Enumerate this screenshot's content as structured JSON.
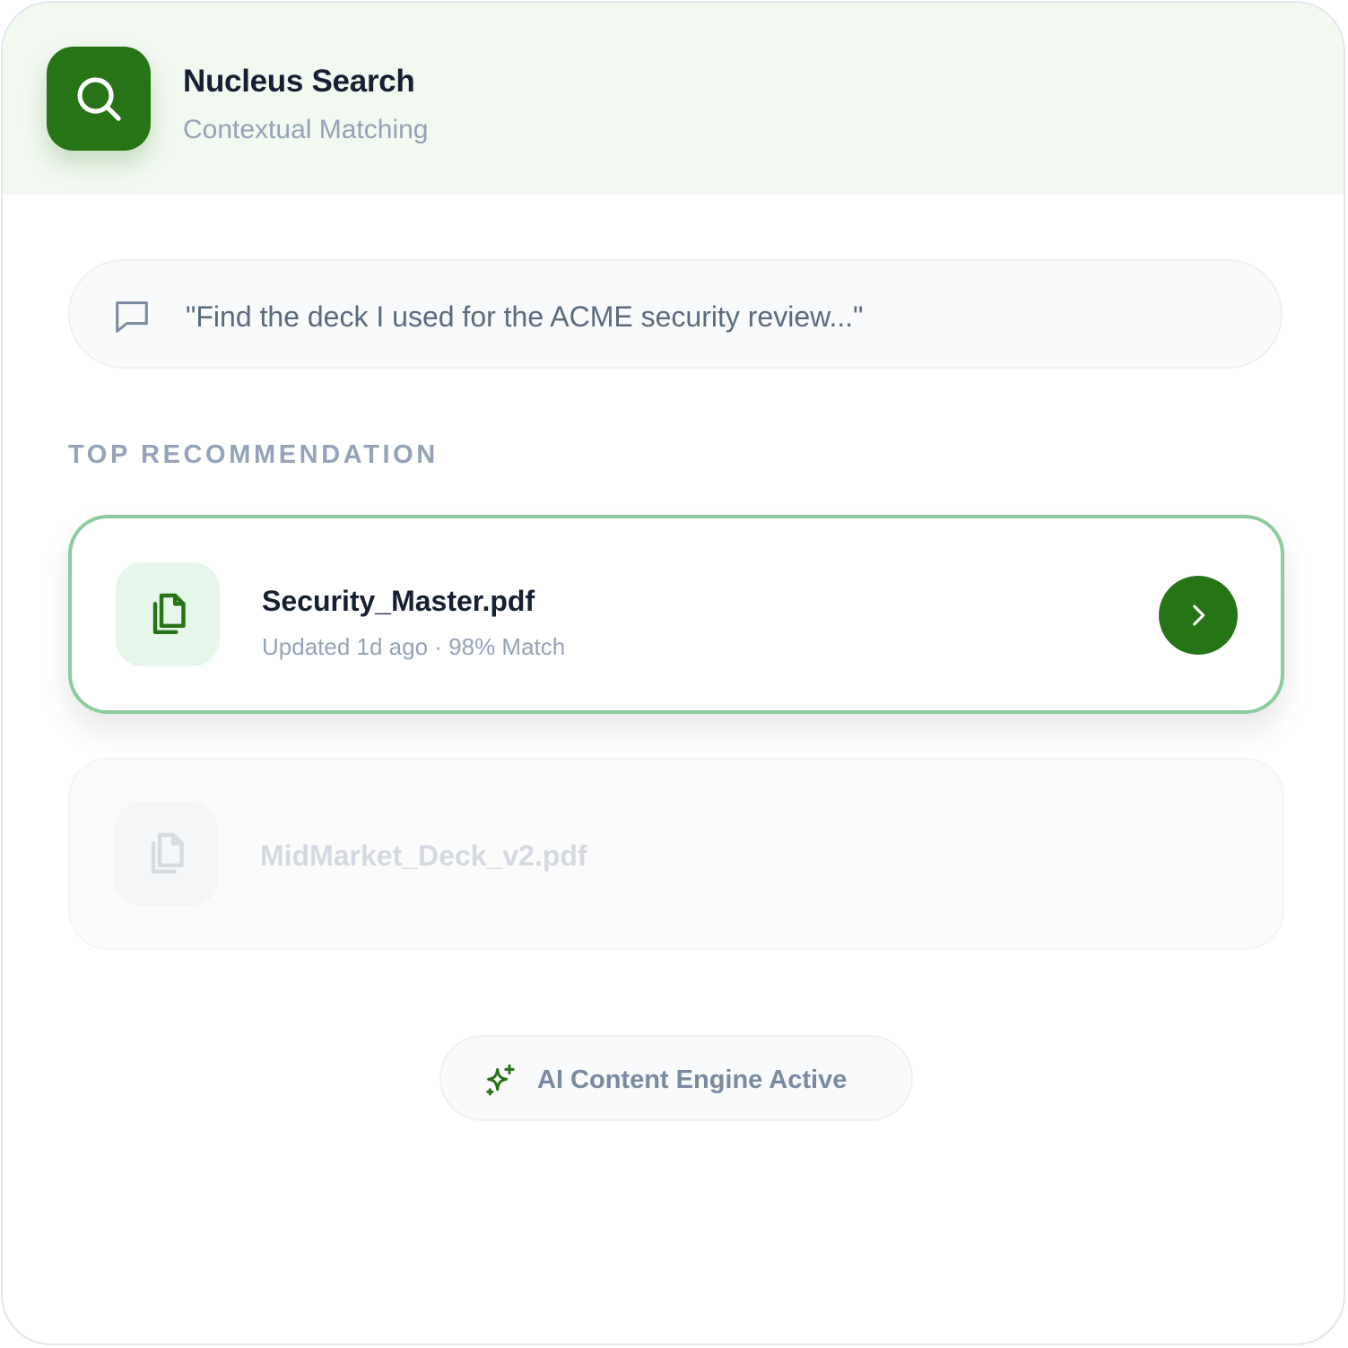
{
  "header": {
    "title": "Nucleus Search",
    "subtitle": "Contextual Matching",
    "icon": "search-icon"
  },
  "query": {
    "icon": "chat-bubble-icon",
    "text": "\"Find the deck I used for the ACME security review...\""
  },
  "section": {
    "label": "TOP RECOMMENDATION"
  },
  "results": [
    {
      "name": "Security_Master.pdf",
      "meta": "Updated 1d ago · 98% Match",
      "icon": "file-copy-icon",
      "action_icon": "chevron-right-icon"
    },
    {
      "name": "MidMarket_Deck_v2.pdf",
      "icon": "file-copy-icon"
    }
  ],
  "status": {
    "icon": "sparkles-icon",
    "label": "AI Content Engine Active"
  },
  "colors": {
    "brand": "#277417",
    "header_bg": "#f2f9f1",
    "highlight_border": "#8ccc9f",
    "tile_bg": "#e6f6ea",
    "muted_text": "#94a3b8",
    "dark_text": "#172033"
  }
}
